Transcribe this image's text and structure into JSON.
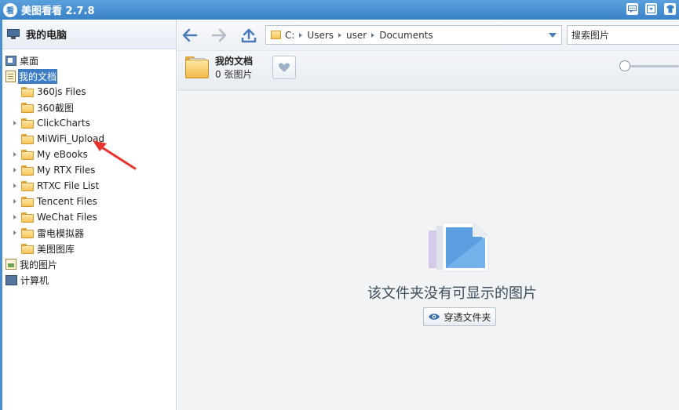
{
  "app": {
    "title": "美图看看 2.7.8",
    "icon_char": "看"
  },
  "window_controls": [
    {
      "name": "feedback-icon"
    },
    {
      "name": "menu-icon"
    },
    {
      "name": "skin-icon"
    }
  ],
  "sidebar": {
    "header": "我的电脑",
    "items": [
      {
        "label": "桌面",
        "icon": "desktop-icon",
        "level": 0,
        "expandable": false
      },
      {
        "label": "我的文档",
        "icon": "documents-icon",
        "level": 0,
        "expandable": false,
        "selected": true
      },
      {
        "label": "360js Files",
        "icon": "folder-icon",
        "level": 1,
        "expandable": false
      },
      {
        "label": "360截图",
        "icon": "folder-icon",
        "level": 1,
        "expandable": false
      },
      {
        "label": "ClickCharts",
        "icon": "folder-icon",
        "level": 1,
        "expandable": true
      },
      {
        "label": "MiWiFi_Upload",
        "icon": "folder-icon",
        "level": 1,
        "expandable": false
      },
      {
        "label": "My eBooks",
        "icon": "folder-icon",
        "level": 1,
        "expandable": true
      },
      {
        "label": "My RTX Files",
        "icon": "folder-icon",
        "level": 1,
        "expandable": true
      },
      {
        "label": "RTXC File List",
        "icon": "folder-icon",
        "level": 1,
        "expandable": true
      },
      {
        "label": "Tencent Files",
        "icon": "folder-icon",
        "level": 1,
        "expandable": true
      },
      {
        "label": "WeChat Files",
        "icon": "folder-icon",
        "level": 1,
        "expandable": true
      },
      {
        "label": "雷电模拟器",
        "icon": "folder-icon",
        "level": 1,
        "expandable": true
      },
      {
        "label": "美图图库",
        "icon": "folder-icon",
        "level": 1,
        "expandable": false
      },
      {
        "label": "我的图片",
        "icon": "pictures-icon",
        "level": 0,
        "expandable": false
      },
      {
        "label": "计算机",
        "icon": "computer-icon",
        "level": 0,
        "expandable": false
      }
    ]
  },
  "toolbar": {
    "path": [
      "C:",
      "Users",
      "user",
      "Documents"
    ],
    "search_placeholder": "搜索图片"
  },
  "folder_info": {
    "name": "我的文档",
    "count": "0 张图片"
  },
  "empty_state": {
    "message": "该文件夹没有可显示的图片",
    "button_label": "穿透文件夹"
  },
  "colors": {
    "titlebar": "#3a82c8",
    "selection": "#3c7dc6",
    "annotation_arrow": "#e8342e"
  }
}
